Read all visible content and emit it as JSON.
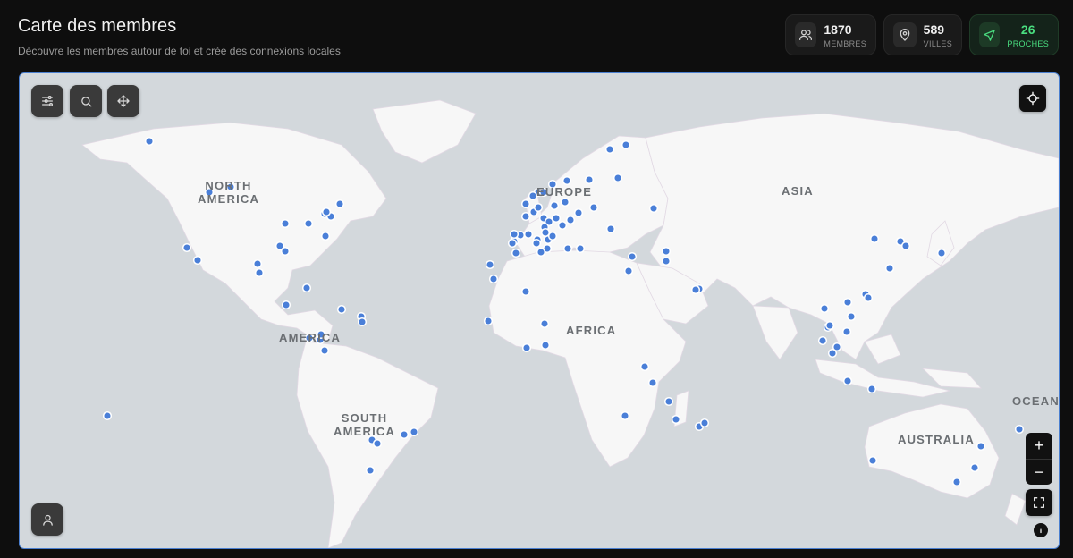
{
  "header": {
    "title": "Carte des membres",
    "subtitle": "Découvre les membres autour de toi et crée des connexions locales"
  },
  "stats": {
    "members": {
      "value": "1870",
      "label": "MEMBRES",
      "icon": "users-icon"
    },
    "cities": {
      "value": "589",
      "label": "VILLES",
      "icon": "map-pin-icon"
    },
    "nearby": {
      "value": "26",
      "label": "PROCHES",
      "icon": "navigation-icon"
    }
  },
  "map": {
    "labels": {
      "north_america_1": "NORTH",
      "north_america_2": "AMERICA",
      "america": "AMERICA",
      "europe": "EUROPE",
      "asia": "ASIA",
      "africa": "AFRICA",
      "south_america_1": "SOUTH",
      "south_america_2": "AMERICA",
      "australia": "AUSTRALIA",
      "oceania": "OCEAN"
    },
    "controls": {
      "filters": "sliders-icon",
      "search": "search-icon",
      "move": "move-icon",
      "locate": "crosshair-icon",
      "zoom_in": "+",
      "zoom_out": "−",
      "fullscreen": "fullscreen-icon",
      "info": "info-icon",
      "profile": "user-icon"
    },
    "colors": {
      "marker": "#4a7fd8",
      "land": "#f7f7f7",
      "water": "#d3d8dc",
      "accent_green": "#4ade80"
    }
  }
}
